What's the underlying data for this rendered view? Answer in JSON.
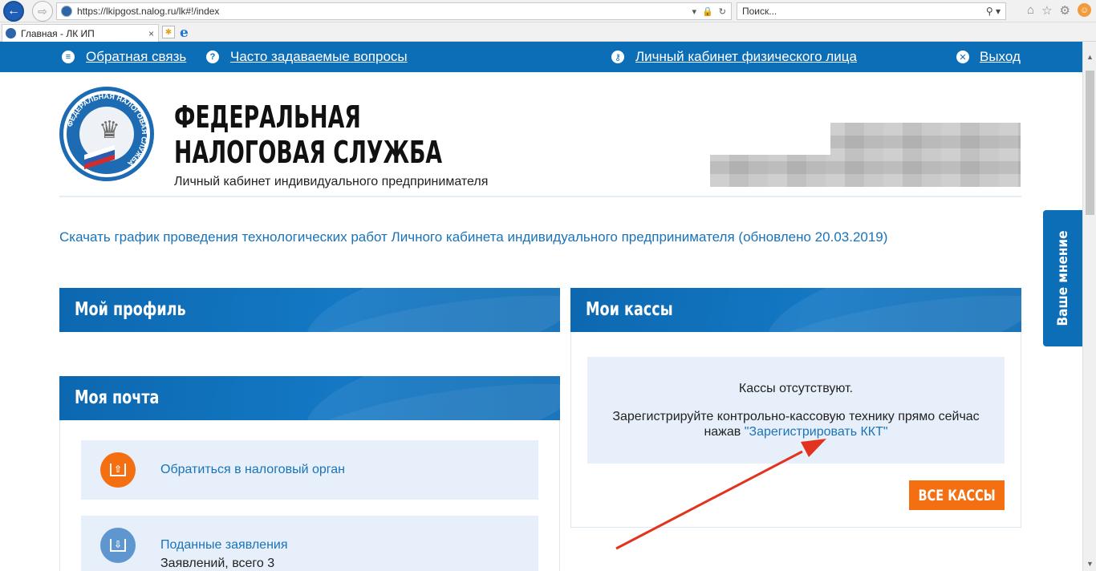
{
  "browser": {
    "url": "https://lkipgost.nalog.ru/lk#!/index",
    "search_placeholder": "Поиск...",
    "tab_title": "Главная - ЛК ИП",
    "tab_close": "×",
    "icons": {
      "back": "back-arrow-icon",
      "forward": "forward-arrow-icon",
      "home": "home-icon",
      "favorites": "star-icon",
      "settings": "gear-icon",
      "feedback": "smiley-icon"
    }
  },
  "topnav": {
    "feedback": "Обратная связь",
    "faq": "Часто задаваемые вопросы",
    "personal": "Личный кабинет физического лица",
    "logout": "Выход"
  },
  "header": {
    "title_line1": "ФЕДЕРАЛЬНАЯ",
    "title_line2": "НАЛОГОВАЯ СЛУЖБА",
    "subtitle": "Личный кабинет индивидуального предпринимателя",
    "emblem_text": "ФЕДЕРАЛЬНАЯ НАЛОГОВАЯ СЛУЖБА"
  },
  "notice": {
    "link": "Скачать график проведения технологических работ Личного кабинета индивидуального предпринимателя (обновлено 20.03.2019)"
  },
  "profile": {
    "title": "Мой профиль"
  },
  "kassy": {
    "title": "Мои кассы",
    "empty": "Кассы отсутствуют.",
    "hint_before": "Зарегистрируйте контрольно-кассовую технику прямо сейчас нажав ",
    "hint_link": "\"Зарегистрировать ККТ\"",
    "all_button": "ВСЕ КАССЫ"
  },
  "mail": {
    "title": "Моя почта",
    "items": [
      {
        "title": "Обратиться в налоговый орган",
        "icon": "upload-tray-icon"
      },
      {
        "title": "Поданные заявления",
        "sub": "Заявлений, всего 3",
        "icon": "download-tray-icon"
      }
    ]
  },
  "feedback_tab": "Ваше мнение",
  "colors": {
    "brand_blue": "#0d6eb8",
    "link_blue": "#1a73b8",
    "accent_orange": "#f36f12",
    "panel_bg": "#e7f0fa",
    "annotation_red": "#e3321e"
  }
}
